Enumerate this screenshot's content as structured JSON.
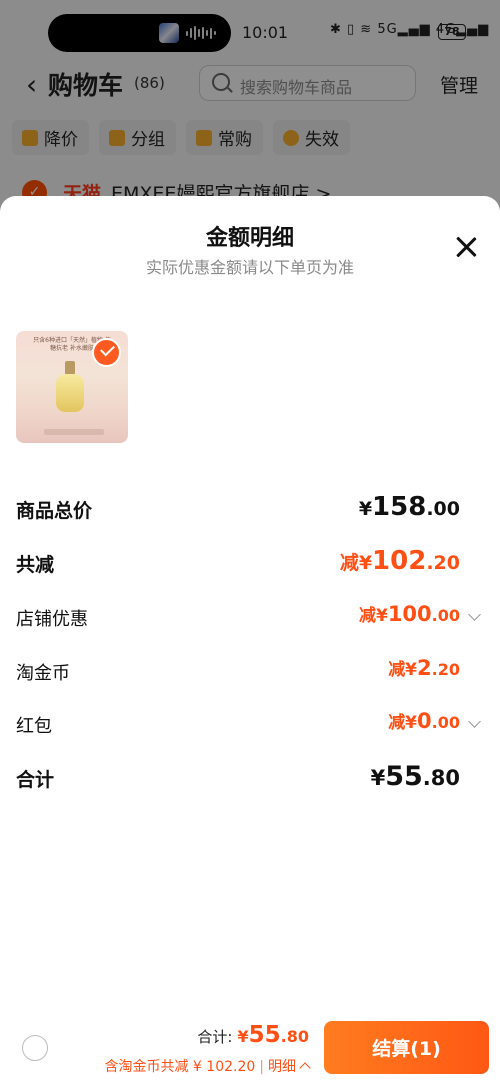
{
  "status_bar": {
    "time": "10:01",
    "icons": [
      "bluetooth-icon",
      "vibrate-icon",
      "wifi-icon",
      "5g-signal-icon",
      "4g-signal-icon"
    ],
    "icons_text": "✱ ▯ ≋ 5G▂▄▆ 4G▂▄▆",
    "battery": "78"
  },
  "cart_header": {
    "title": "购物车",
    "count": "(86)",
    "search_placeholder": "搜索购物车商品",
    "manage": "管理"
  },
  "filters": [
    {
      "label": "降价",
      "icon": "price-down-icon"
    },
    {
      "label": "分组",
      "icon": "folder-icon"
    },
    {
      "label": "常购",
      "icon": "cart-icon"
    },
    {
      "label": "失效",
      "icon": "invalid-icon"
    }
  ],
  "store": {
    "tag": "天猫",
    "name": "EMXEE嫚熙官方旗舰店 >"
  },
  "sheet": {
    "title": "金额明细",
    "subtitle": "实际优惠金额请以下单页为准",
    "product_caption": "只含6种进口「天然」植物 抗糖抗老 补水嫩肤"
  },
  "details": {
    "total_price": {
      "label": "商品总价",
      "pre": "¥",
      "int": "158",
      "dec": ".00"
    },
    "total_reduction": {
      "label": "共减",
      "pre": "减¥",
      "int": "102",
      "dec": ".20"
    },
    "store_discount": {
      "label": "店铺优惠",
      "pre": "减¥",
      "int": "100",
      "dec": ".00"
    },
    "taojinbi": {
      "label": "淘金币",
      "pre": "减¥",
      "int": "2",
      "dec": ".20"
    },
    "hongbao": {
      "label": "红包",
      "pre": "减¥",
      "int": "0",
      "dec": ".00"
    },
    "sum": {
      "label": "合计",
      "pre": "¥",
      "int": "55",
      "dec": ".80"
    }
  },
  "footer": {
    "total_label": "合计:",
    "total_pre": "¥",
    "total_int": "55",
    "total_dec": ".80",
    "saving_text": "含淘金币共减 ¥ 102.20",
    "separator": "|",
    "detail_link": "明细",
    "checkout_label": "结算(1)"
  },
  "colors": {
    "accent": "#ff4f14",
    "checkout": "#ff6a1a"
  }
}
